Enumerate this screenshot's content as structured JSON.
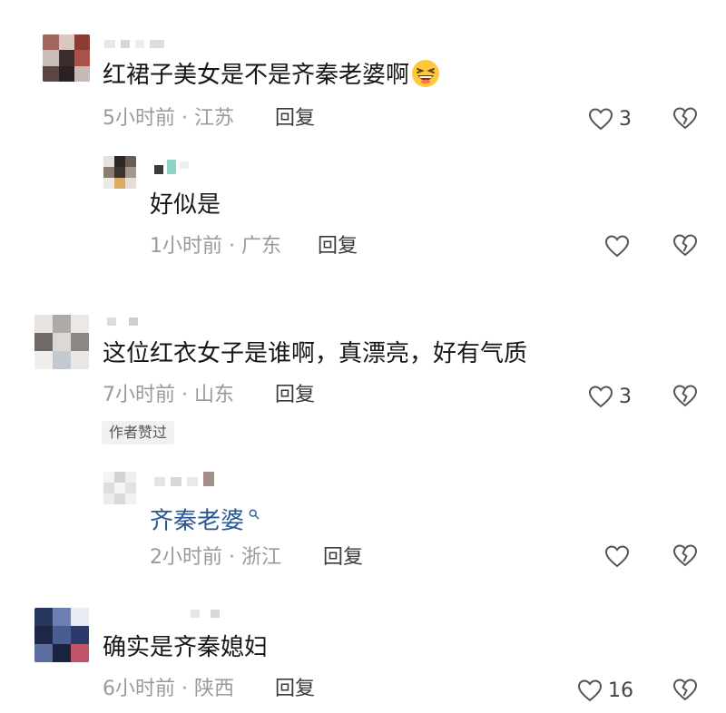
{
  "comments": [
    {
      "text": "红裙子美女是不是齐秦老婆啊",
      "emoji": "grinning-squint-face",
      "time_location": "5小时前 · 江苏",
      "reply_label": "回复",
      "likes": "3",
      "replies": [
        {
          "text": "好似是",
          "time_location": "1小时前 · 广东",
          "reply_label": "回复",
          "likes": ""
        }
      ]
    },
    {
      "text": "这位红衣女子是谁啊，真漂亮，好有气质",
      "time_location": "7小时前 · 山东",
      "reply_label": "回复",
      "likes": "3",
      "author_badge": "作者赞过",
      "replies": [
        {
          "mention": "齐秦老婆",
          "time_location": "2小时前 · 浙江",
          "reply_label": "回复",
          "likes": ""
        }
      ]
    },
    {
      "text": "确实是齐秦媳妇",
      "time_location": "6小时前 · 陕西",
      "reply_label": "回复",
      "likes": "16"
    }
  ],
  "icons": {
    "like": "heart-outline-icon",
    "dislike": "broken-heart-icon",
    "mention_search": "search-icon"
  },
  "colors": {
    "mention": "#2b5891",
    "meta": "#9a9a9a",
    "badge_bg": "#f1f1f1"
  }
}
